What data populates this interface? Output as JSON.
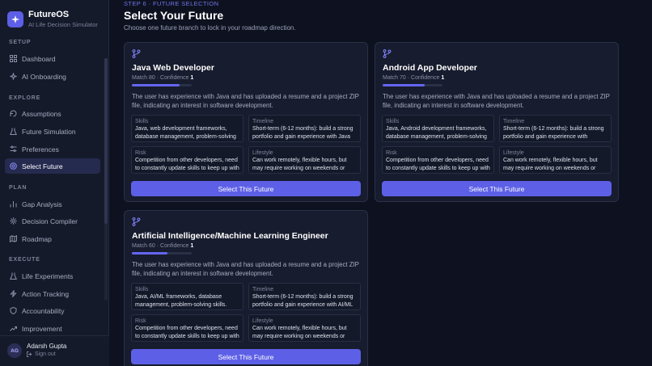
{
  "app": {
    "name": "FutureOS",
    "subtitle": "AI Life Decision Simulator"
  },
  "sidebar": {
    "sections": [
      {
        "label": "SETUP",
        "items": [
          {
            "label": "Dashboard",
            "icon": "grid-icon"
          },
          {
            "label": "AI Onboarding",
            "icon": "sparkle-icon"
          }
        ]
      },
      {
        "label": "EXPLORE",
        "items": [
          {
            "label": "Assumptions",
            "icon": "sliders-icon"
          },
          {
            "label": "Future Simulation",
            "icon": "flask-icon"
          },
          {
            "label": "Preferences",
            "icon": "sliders-icon"
          },
          {
            "label": "Select Future",
            "icon": "target-icon",
            "active": true
          }
        ]
      },
      {
        "label": "PLAN",
        "items": [
          {
            "label": "Gap Analysis",
            "icon": "chart-icon"
          },
          {
            "label": "Decision Compiler",
            "icon": "cog-icon"
          },
          {
            "label": "Roadmap",
            "icon": "map-icon"
          }
        ]
      },
      {
        "label": "EXECUTE",
        "items": [
          {
            "label": "Life Experiments",
            "icon": "flask-icon"
          },
          {
            "label": "Action Tracking",
            "icon": "zap-icon"
          },
          {
            "label": "Accountability",
            "icon": "shield-icon"
          },
          {
            "label": "Improvement",
            "icon": "trend-icon"
          }
        ]
      }
    ],
    "user": {
      "initials": "AG",
      "name": "Adarsh Gupta",
      "signout": "Sign out"
    }
  },
  "header": {
    "step": "STEP 6 · FUTURE SELECTION",
    "title": "Select Your Future",
    "subtitle": "Choose one future branch to lock in your roadmap direction."
  },
  "cards": [
    {
      "title": "Java Web Developer",
      "match_label": "Match 80 · Confidence",
      "confidence": "1",
      "match": 80,
      "description": "The user has experience with Java and has uploaded a resume and a project ZIP file, indicating an interest in software development.",
      "skills_label": "Skills",
      "skills": "Java, web development frameworks, database management, problem-solving skills.",
      "timeline_label": "Timeline",
      "timeline": "Short-term (6-12 months): build a strong portfolio and gain experience with Java web frameworks.",
      "risk_label": "Risk",
      "risk": "Competition from other developers, need to constantly update skills to keep up with new technologies.",
      "lifestyle_label": "Lifestyle",
      "lifestyle": "Can work remotely, flexible hours, but may require working on weekends or evenings.",
      "button": "Select This Future"
    },
    {
      "title": "Android App Developer",
      "match_label": "Match 70 · Confidence",
      "confidence": "1",
      "match": 70,
      "description": "The user has experience with Java and has uploaded a resume and a project ZIP file, indicating an interest in software development.",
      "skills_label": "Skills",
      "skills": "Java, Android development frameworks, database management, problem-solving skills.",
      "timeline_label": "Timeline",
      "timeline": "Short-term (6-12 months): build a strong portfolio and gain experience with Android development.",
      "risk_label": "Risk",
      "risk": "Competition from other developers, need to constantly update skills to keep up with new technologies.",
      "lifestyle_label": "Lifestyle",
      "lifestyle": "Can work remotely, flexible hours, but may require working on weekends or evenings.",
      "button": "Select This Future"
    },
    {
      "title": "Artificial Intelligence/Machine Learning Engineer",
      "match_label": "Match 60 · Confidence",
      "confidence": "1",
      "match": 60,
      "description": "The user has experience with Java and has uploaded a resume and a project ZIP file, indicating an interest in software development.",
      "skills_label": "Skills",
      "skills": "Java, AI/ML frameworks, database management, problem-solving skills.",
      "timeline_label": "Timeline",
      "timeline": "Short-term (6-12 months): build a strong portfolio and gain experience with AI/ML frameworks.",
      "risk_label": "Risk",
      "risk": "Competition from other developers, need to constantly update skills to keep up with new technologies.",
      "lifestyle_label": "Lifestyle",
      "lifestyle": "Can work remotely, flexible hours, but may require working on weekends or evenings.",
      "button": "Select This Future"
    }
  ],
  "colors": {
    "accent": "#5d60e6",
    "background": "#0e1220",
    "sidebar": "#151a2a",
    "card": "#171c2e"
  }
}
